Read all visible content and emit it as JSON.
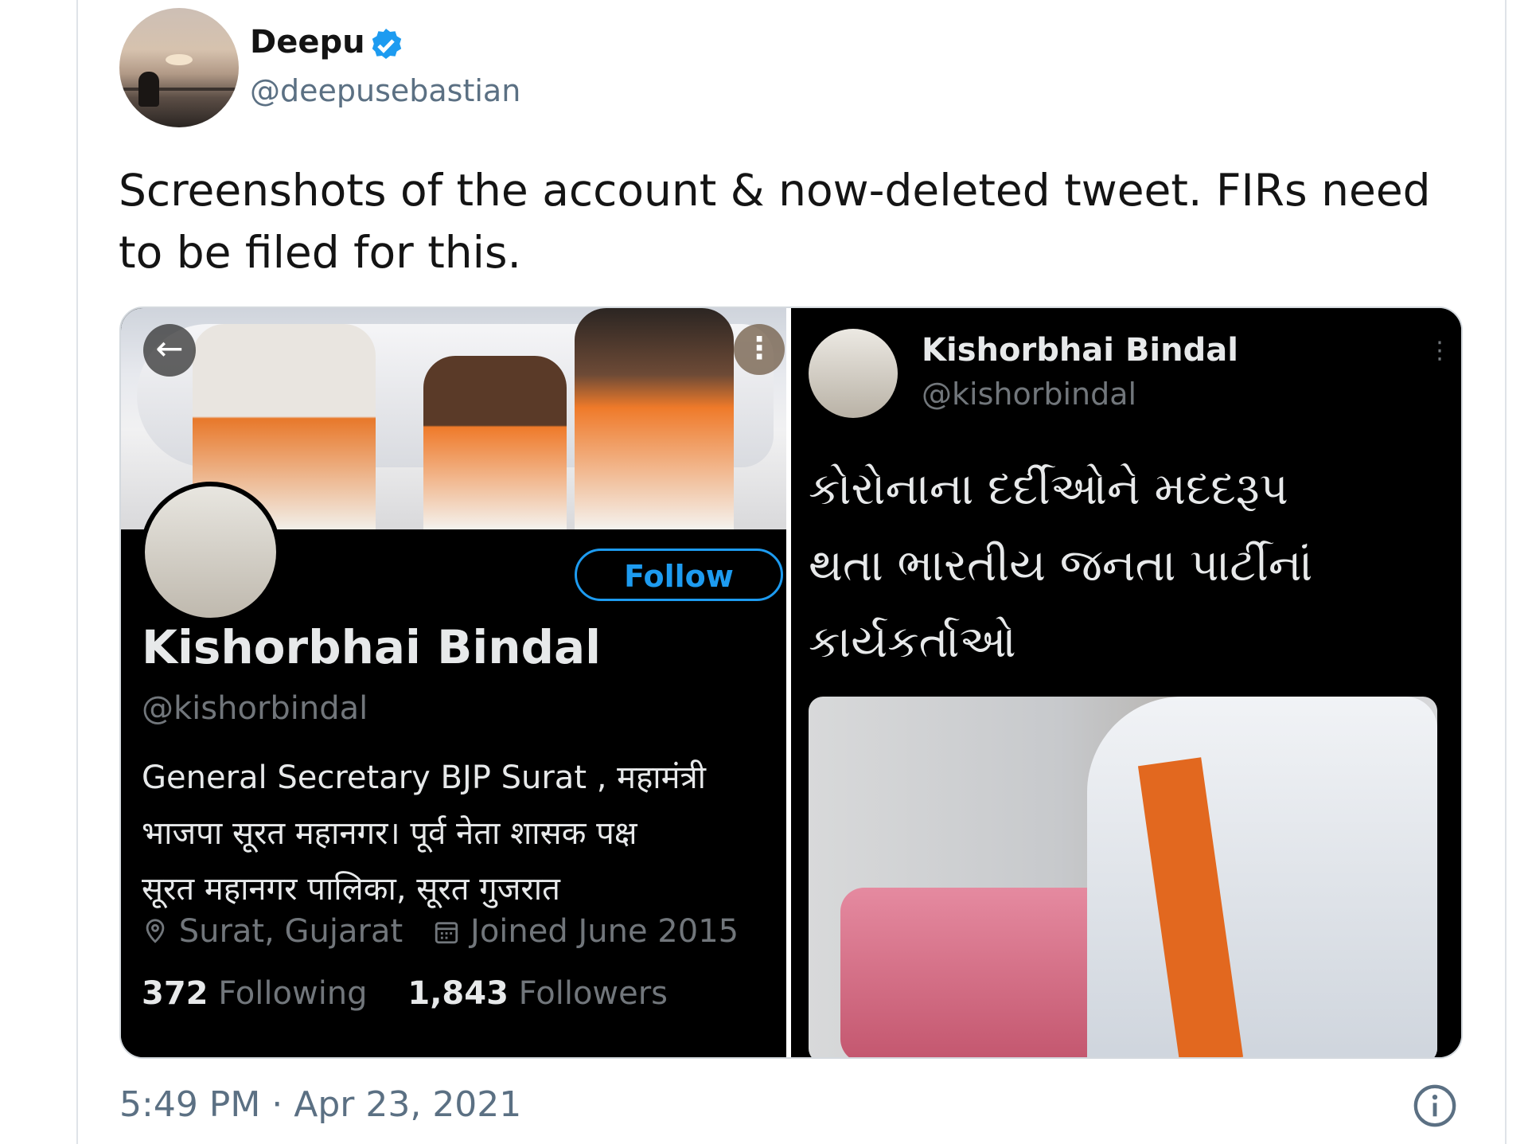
{
  "author": {
    "name": "Deepu",
    "handle": "@deepusebastian",
    "verified": true
  },
  "tweet": {
    "text": "Screenshots of the account & now-deleted tweet. FIRs need to be filed for this.",
    "timestamp": "5:49 PM · Apr 23, 2021"
  },
  "left_screenshot": {
    "follow_label": "Follow",
    "name": "Kishorbhai Bindal",
    "handle": "@kishorbindal",
    "bio_lines": [
      "General Secretary BJP Surat , महामंत्री",
      "भाजपा सूरत महानगर।  पूर्व नेता शासक पक्ष",
      "सूरत महानगर पालिका, सूरत गुजरात"
    ],
    "location": "Surat, Gujarat",
    "joined": "Joined June 2015",
    "following_count": "372",
    "following_label": "Following",
    "followers_count": "1,843",
    "followers_label": "Followers"
  },
  "right_screenshot": {
    "name": "Kishorbhai Bindal",
    "handle": "@kishorbindal",
    "text_lines": [
      "કોરોનાના દર્દીઓને મદદરૂપ",
      "થતા ભારતીય જનતા પાર્ટીનાં",
      "કાર્યકર્તાઓ"
    ]
  },
  "colors": {
    "verified_blue": "#1d9bf0",
    "secondary_text": "#5b7083"
  }
}
